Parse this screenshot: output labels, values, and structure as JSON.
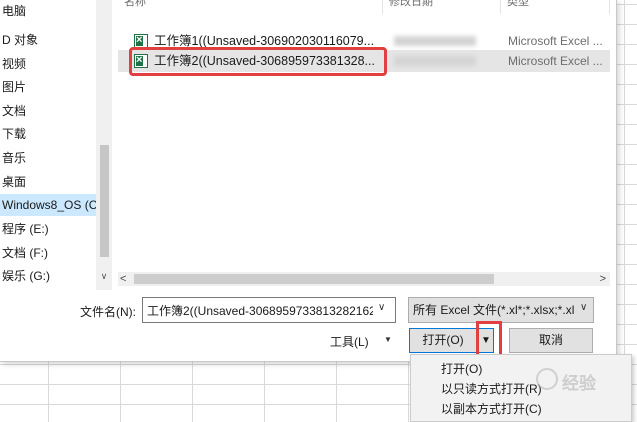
{
  "nav": {
    "items": [
      {
        "label": "电脑"
      },
      {
        "label": "D 对象"
      },
      {
        "label": "视频"
      },
      {
        "label": "图片"
      },
      {
        "label": "文档"
      },
      {
        "label": "下载"
      },
      {
        "label": "音乐"
      },
      {
        "label": "桌面"
      },
      {
        "label": "Windows8_OS (C"
      },
      {
        "label": "程序 (E:)"
      },
      {
        "label": "文档 (F:)"
      },
      {
        "label": "娱乐 (G:)"
      }
    ]
  },
  "file_list": {
    "columns": [
      "名称",
      "修改日期",
      "类型"
    ],
    "rows": [
      {
        "name": "工作簿1((Unsaved-306902030116079...",
        "type": "Microsoft Excel ..."
      },
      {
        "name": "工作簿2((Unsaved-306895973381328...",
        "type": "Microsoft Excel ..."
      }
    ]
  },
  "footer": {
    "filename_label": "文件名(N):",
    "filename_value": "工作簿2((Unsaved-3068959733813282162",
    "filetype_value": "所有 Excel 文件(*.xl*;*.xlsx;*.xl",
    "tools_label": "工具(L)",
    "open_label": "打开(O)",
    "cancel_label": "取消"
  },
  "open_menu": {
    "items": [
      "打开(O)",
      "以只读方式打开(R)",
      "以副本方式打开(C)"
    ]
  },
  "watermark": {
    "text": "经验"
  },
  "colors": {
    "highlight": "#e0403f",
    "selection": "#cce8ff",
    "excel_green": "#1f7244"
  }
}
